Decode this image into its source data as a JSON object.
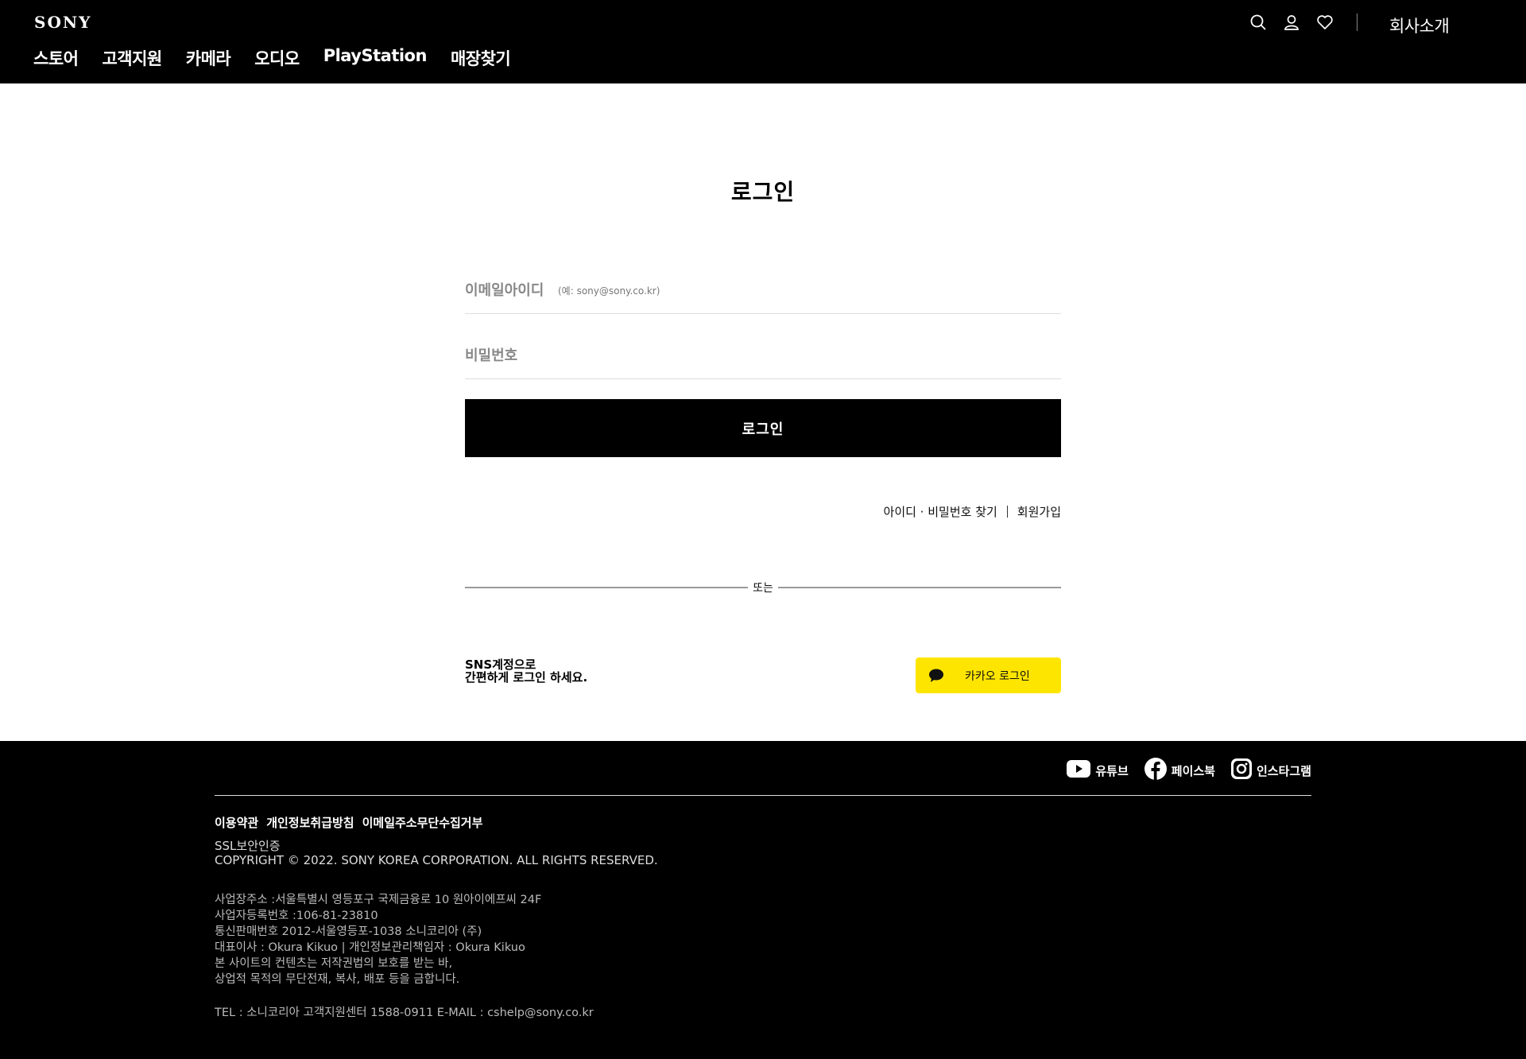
{
  "header": {
    "logo": "SONY",
    "nav": [
      "스토어",
      "고객지원",
      "카메라",
      "오디오",
      "PlayStation",
      "매장찾기"
    ],
    "icons": [
      "search-icon",
      "user-icon",
      "heart-icon"
    ],
    "company_link": "회사소개"
  },
  "login": {
    "title": "로그인",
    "email_label": "이메일아이디",
    "email_hint": "(예: sony@sony.co.kr)",
    "email_value": "",
    "password_label": "비밀번호",
    "password_value": "",
    "submit_label": "로그인",
    "find_link": "아이디 · 비밀번호 찾기",
    "signup_link": "회원가입",
    "or_text": "또는",
    "sns_line1": "SNS계정으로",
    "sns_line2": "간편하게 로그인 하세요.",
    "kakao_label": "카카오 로그인",
    "kakao_color": "#fee500"
  },
  "footer": {
    "socials": [
      {
        "icon": "youtube-icon",
        "label": "유튜브"
      },
      {
        "icon": "facebook-icon",
        "label": "페이스북"
      },
      {
        "icon": "instagram-icon",
        "label": "인스타그램"
      }
    ],
    "links": [
      "이용약관",
      "개인정보취급방침",
      "이메일주소무단수집거부"
    ],
    "ssl": "SSL보안인증",
    "copyright": "COPYRIGHT © 2022. SONY KOREA CORPORATION. ALL RIGHTS RESERVED.",
    "info": [
      "사업장주소 :서울특별시 영등포구 국제금융로 10 원아이에프씨 24F",
      "사업자등록번호 :106-81-23810",
      "통신판매번호 2012-서울영등포-1038 소니코리아 (주)",
      "대표이사 : Okura Kikuo | 개인정보관리책임자 : Okura Kikuo",
      "본 사이트의 컨텐츠는 저작권법의 보호를 받는 바,",
      "상업적 목적의 무단전재, 복사, 배포 등을 금합니다."
    ],
    "tel": "TEL : 소니코리아 고객지원센터 1588-0911 E-MAIL : cshelp@sony.co.kr"
  }
}
